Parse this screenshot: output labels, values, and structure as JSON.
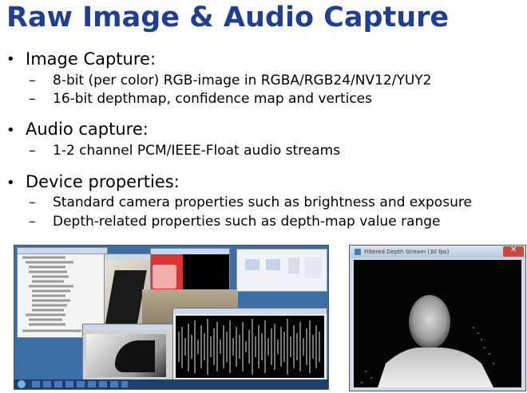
{
  "title": "Raw Image & Audio Capture",
  "bullets": [
    {
      "label": "Image Capture:",
      "subs": [
        "8-bit (per color) RGB-image in RGBA/RGB24/NV12/YUY2",
        "16-bit depthmap, confidence map and vertices"
      ]
    },
    {
      "label": "Audio capture:",
      "subs": [
        "1-2 channel PCM/IEEE-Float audio streams"
      ]
    },
    {
      "label": "Device properties:",
      "subs": [
        "Standard camera properties such as brightness and exposure",
        "Depth-related properties such as depth-map value range"
      ]
    }
  ],
  "bullet_glyph": "•",
  "dash_glyph": "–",
  "depth_window_title": "Filtered Depth Stream (30 fps)",
  "colors": {
    "title": "#1f3f93",
    "desktop_bg": "#3a6ea5",
    "taskbar": "#1c3f6e",
    "depth_bg": "#050505"
  }
}
